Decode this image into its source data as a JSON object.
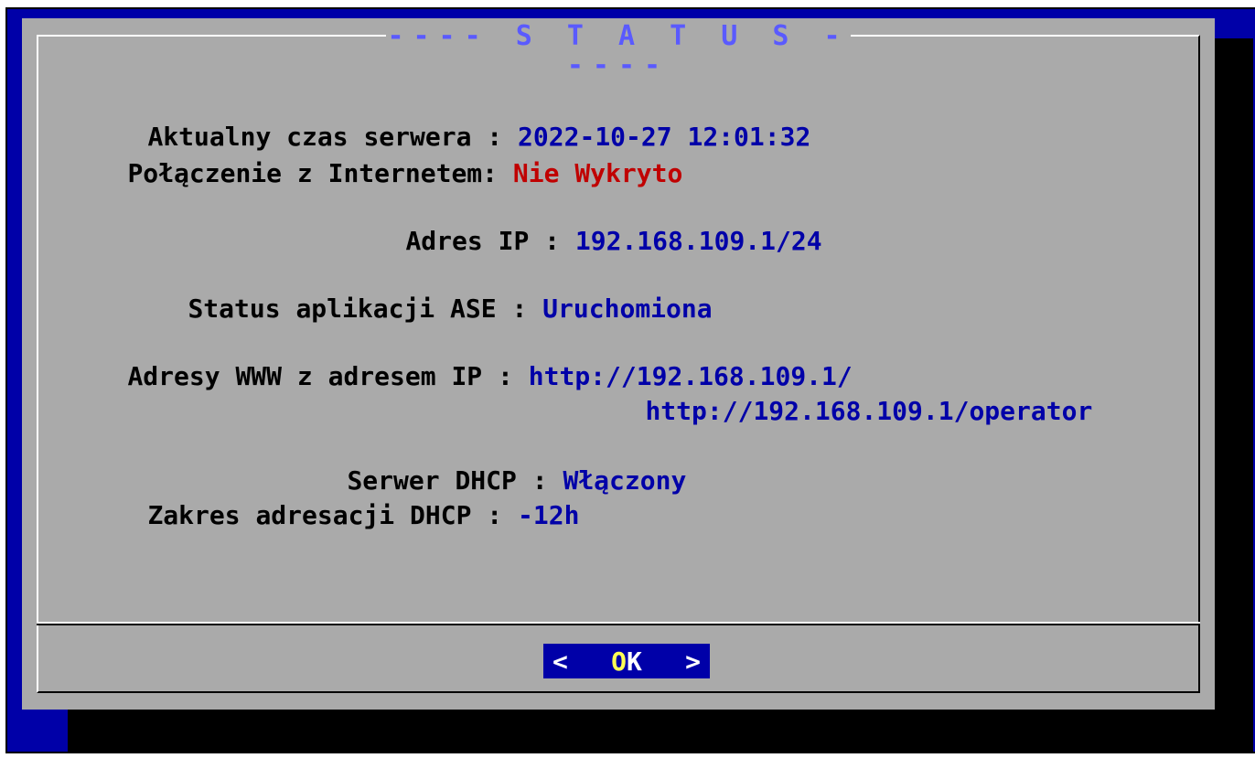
{
  "dialog": {
    "title": "---- S T A T U S -----",
    "rows": [
      {
        "label": "Aktualny czas serwera",
        "sep": " : ",
        "value": "2022-10-27 12:01:32"
      },
      {
        "label": "Połączenie z Internetem",
        "sep": ": ",
        "value": "Nie Wykryto"
      },
      {
        "label": "Adres IP",
        "sep": " : ",
        "value": "192.168.109.1/24"
      },
      {
        "label": "Status aplikacji ASE",
        "sep": " : ",
        "value": "Uruchomiona"
      },
      {
        "label": "Adresy WWW z adresem IP",
        "sep": " : ",
        "value": "http://192.168.109.1/"
      },
      {
        "value2": "http://192.168.109.1/operator"
      },
      {
        "label": "Serwer DHCP",
        "sep": " : ",
        "value": "Włączony"
      },
      {
        "label": "Zakres adresacji DHCP",
        "sep": " : ",
        "value": "-12h"
      }
    ],
    "ok_button": {
      "left": "<",
      "label_o": "O",
      "label_k": "K",
      "right": ">"
    }
  },
  "colors": {
    "background": "#0000a8",
    "dialog": "#aaaaaa",
    "value": "#0000a8",
    "error": "#c00000",
    "title": "#5a5aff",
    "button_accent": "#ffff55"
  }
}
